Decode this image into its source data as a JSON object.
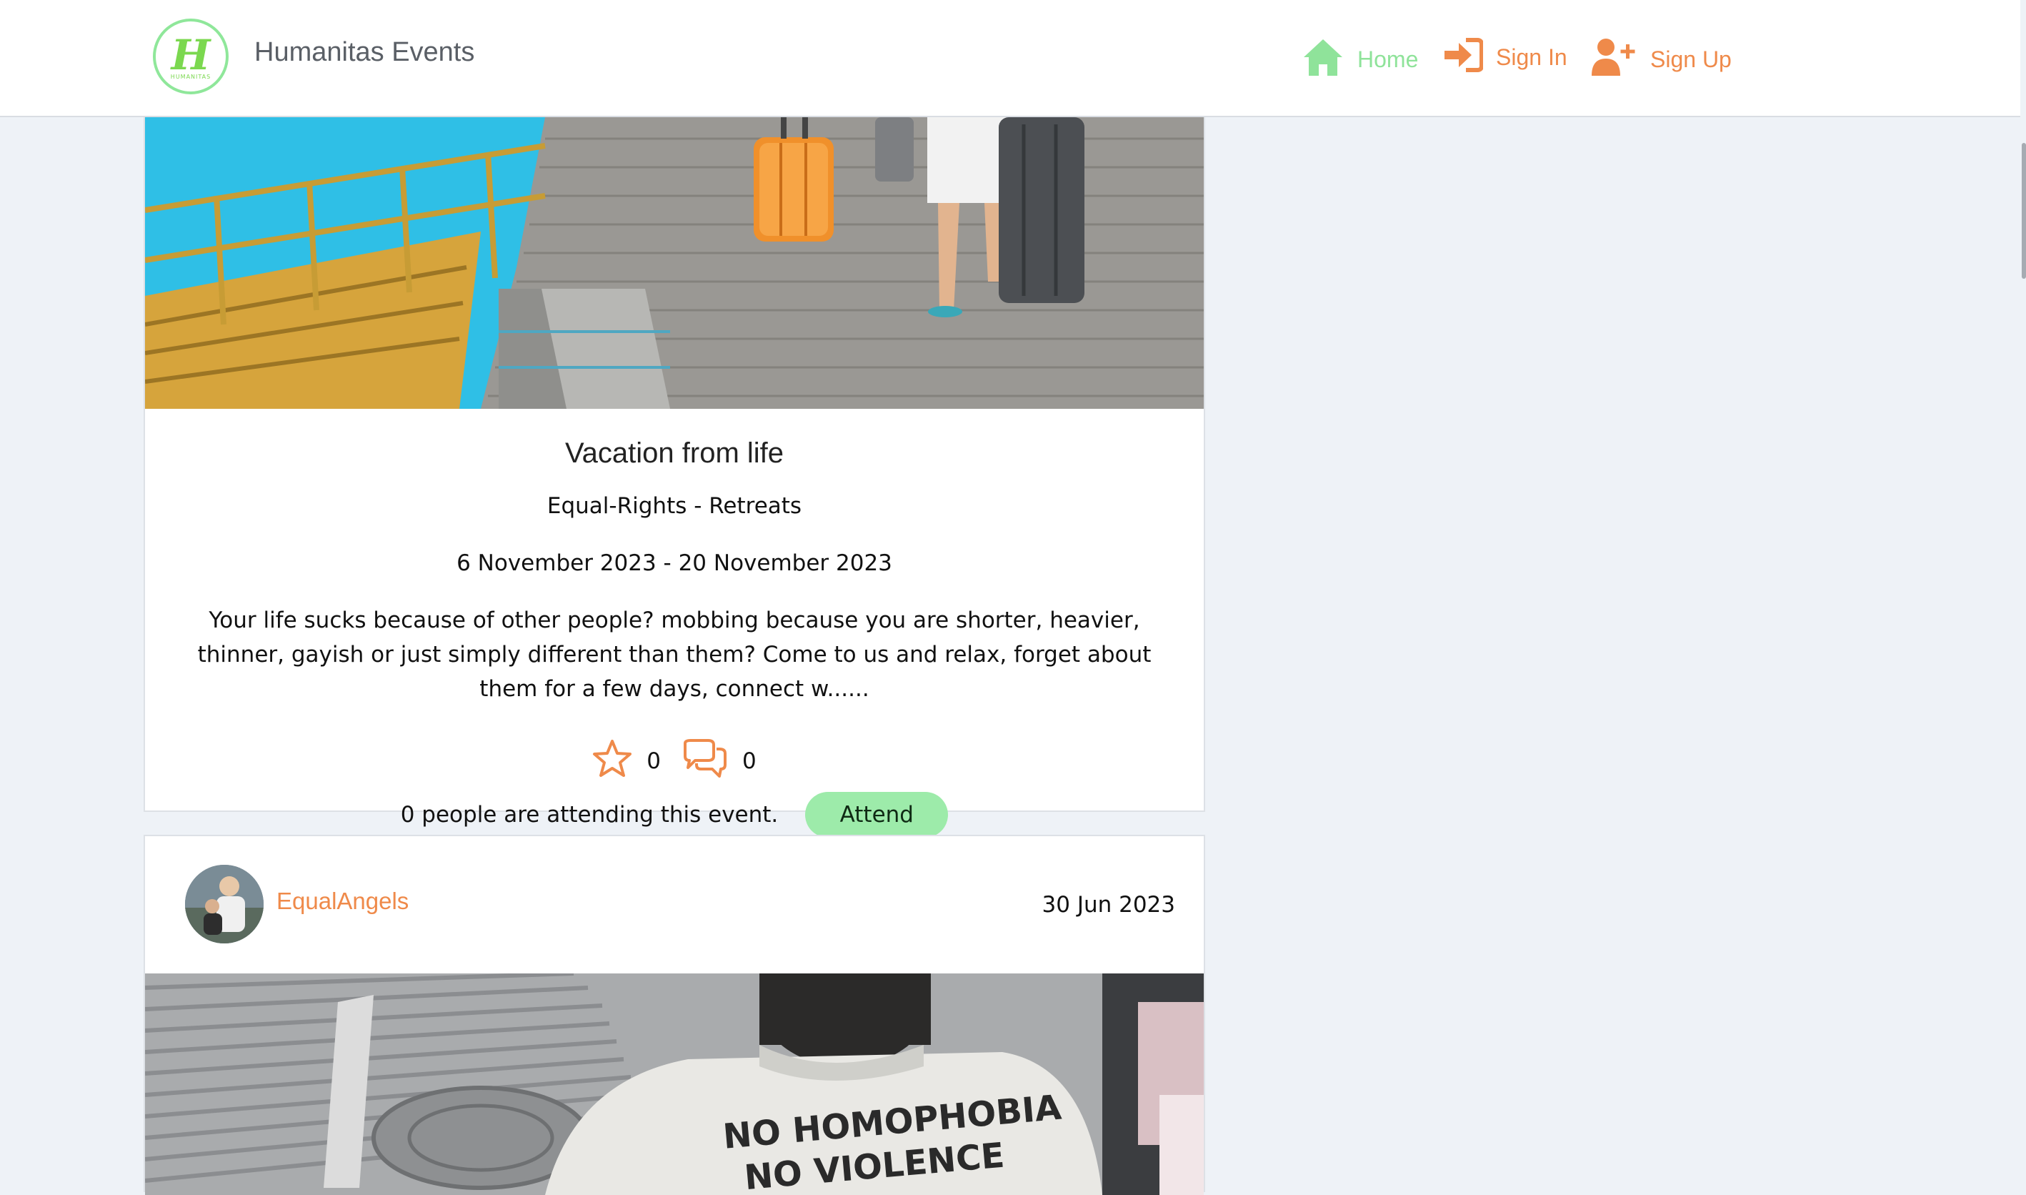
{
  "nav": {
    "brand": "Humanitas Events",
    "logo_letter": "H",
    "logo_small_text": "HUMANITAS",
    "home_label": "Home",
    "signin_label": "Sign In",
    "signup_label": "Sign Up",
    "colors": {
      "home": "#8fe39a",
      "accent": "#ef8a4a"
    }
  },
  "event": {
    "title": "Vacation from life",
    "category": "Equal-Rights - Retreats",
    "dates": "6 November 2023 - 20 November 2023",
    "description": "Your life sucks because of other people? mobbing because you are shorter, heavier, thinner, gayish or just simply different than them? Come to us and relax, forget about them for a few days, connect w......",
    "likes": "0",
    "comments": "0",
    "attending_text": "0 people are attending this event.",
    "attend_label": "Attend"
  },
  "post2": {
    "author": "EqualAngels",
    "date": "30 Jun 2023",
    "shirt_text_line1": "NO HOMOPHOBIA",
    "shirt_text_line2": "NO VIOLENCE"
  }
}
